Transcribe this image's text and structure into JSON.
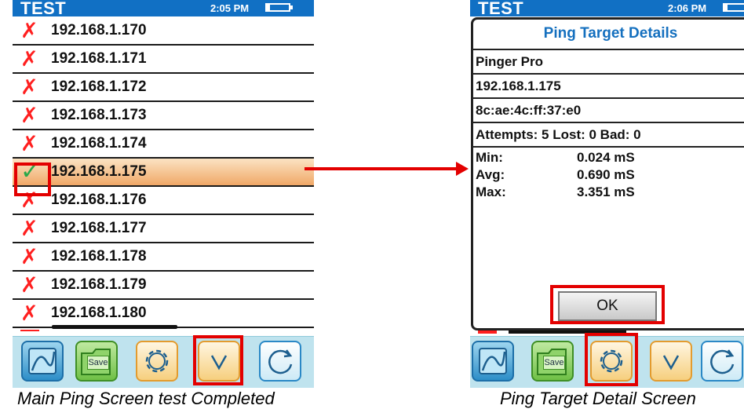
{
  "left_screen": {
    "status": {
      "title": "TEST",
      "time": "2:05 PM"
    },
    "rows": [
      {
        "mark": "✗",
        "ip": "192.168.1.170",
        "status": "failed"
      },
      {
        "mark": "✗",
        "ip": "192.168.1.171",
        "status": "failed"
      },
      {
        "mark": "✗",
        "ip": "192.168.1.172",
        "status": "failed"
      },
      {
        "mark": "✗",
        "ip": "192.168.1.173",
        "status": "failed"
      },
      {
        "mark": "✗",
        "ip": "192.168.1.174",
        "status": "failed"
      },
      {
        "mark": "✓",
        "ip": "192.168.1.175",
        "status": "ok",
        "selected": true
      },
      {
        "mark": "✗",
        "ip": "192.168.1.176",
        "status": "failed"
      },
      {
        "mark": "✗",
        "ip": "192.168.1.177",
        "status": "failed"
      },
      {
        "mark": "✗",
        "ip": "192.168.1.178",
        "status": "failed"
      },
      {
        "mark": "✗",
        "ip": "192.168.1.179",
        "status": "failed"
      },
      {
        "mark": "✗",
        "ip": "192.168.1.180",
        "status": "failed"
      }
    ],
    "toolbar": {
      "save_label": "Save"
    }
  },
  "right_screen": {
    "status": {
      "title": "TEST",
      "time": "2:06 PM"
    },
    "dialog": {
      "title": "Ping Target Details",
      "name": "Pinger Pro",
      "ip": "192.168.1.175",
      "mac": "8c:ae:4c:ff:37:e0",
      "attempts": "Attempts: 5 Lost: 0 Bad: 0",
      "stats": [
        {
          "label": "Min:",
          "value": "0.024 mS"
        },
        {
          "label": "Avg:",
          "value": "0.690 mS"
        },
        {
          "label": "Max:",
          "value": "3.351 mS"
        }
      ],
      "ok_label": "OK"
    },
    "toolbar": {
      "save_label": "Save"
    }
  },
  "captions": {
    "left": "Main Ping Screen test Completed",
    "right": "Ping Target Detail Screen"
  },
  "colors": {
    "statusbar": "#1170c4",
    "fail_mark": "#ff1f1f",
    "ok_mark": "#2aa84a",
    "selected_row": "#f0a867",
    "highlight": "#e30000",
    "dialog_title": "#1570bf",
    "toolbar": "#bfe3ee"
  },
  "icons": {
    "chart": "chart-icon",
    "save": "save-folder-icon",
    "settings": "gear-icon",
    "down": "chevron-down-icon",
    "refresh": "refresh-icon"
  }
}
